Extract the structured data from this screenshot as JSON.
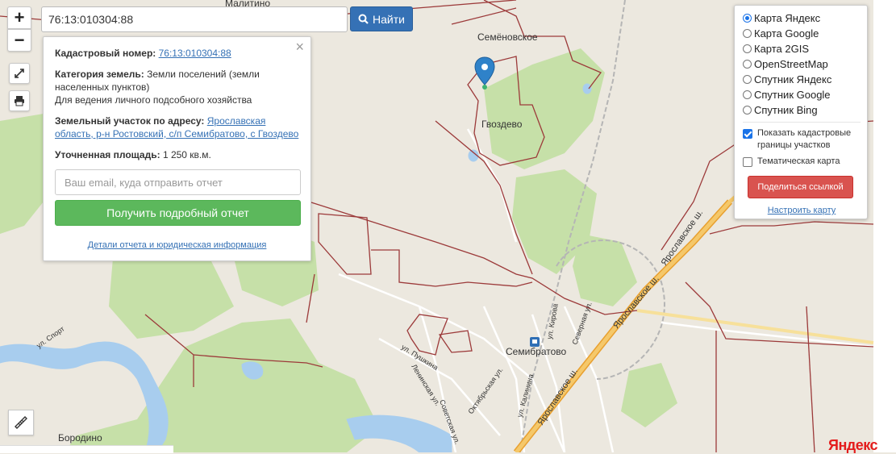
{
  "search": {
    "value": "76:13:010304:88",
    "button_label": "Найти"
  },
  "zoom": {
    "in": "+",
    "out": "−"
  },
  "info": {
    "cadastral_label": "Кадастровый номер:",
    "cadastral_value": "76:13:010304:88",
    "category_label": "Категория земель:",
    "category_value": "Земли поселений (земли населенных пунктов)",
    "usage": "Для ведения личного подсобного хозяйства",
    "address_label": "Земельный участок по адресу:",
    "address_value": "Ярославская область, р-н Ростовский, с/п Семибратово, с Гвоздево",
    "area_label": "Уточненная площадь:",
    "area_value": "1 250 кв.м.",
    "email_placeholder": "Ваш email, куда отправить отчет",
    "report_button": "Получить подробный отчет",
    "details_link": "Детали отчета и юридическая информация"
  },
  "layers": {
    "options": [
      {
        "label": "Карта Яндекс",
        "selected": true
      },
      {
        "label": "Карта Google",
        "selected": false
      },
      {
        "label": "Карта 2GIS",
        "selected": false
      },
      {
        "label": "OpenStreetMap",
        "selected": false
      },
      {
        "label": "Спутник Яндекс",
        "selected": false
      },
      {
        "label": "Спутник Google",
        "selected": false
      },
      {
        "label": "Спутник Bing",
        "selected": false
      }
    ],
    "show_cadastral": {
      "label": "Показать кадастровые границы участков",
      "checked": true
    },
    "thematic": {
      "label": "Тематическая карта",
      "checked": false
    },
    "share_button": "Поделиться ссылкой",
    "settings_link": "Настроить карту"
  },
  "map_labels": {
    "malitino": "Малитино",
    "semenovskoe": "Семёновское",
    "gvozdevo": "Гвоздево",
    "semibratovo": "Семибратово",
    "borodino": "Бородино",
    "yaroslavskoe_1": "Ярославское ш.",
    "yaroslavskoe_2": "Ярославское ш.",
    "yaroslavskoe_3": "Ярославское ш.",
    "pushkina": "ул. Пушкина",
    "leninskaya": "Ленинская ул.",
    "sovetskaya": "Советская ул.",
    "oktyabrskaya": "Октябрьская ул.",
    "kalinina": "ул. Калинина",
    "kirova": "ул. Кирова",
    "severnaya": "Северная ул.",
    "sport": "ул. Спорт",
    "yandex": "Яндекс"
  },
  "colors": {
    "land": "#ece8df",
    "forest": "#c6e0a8",
    "water": "#a8cdee",
    "cadastral_border": "#9c3a3a",
    "highway": "#f2b13a",
    "accent_blue": "#3571b5",
    "green_button": "#5cb85c",
    "red_button": "#d9534f"
  }
}
